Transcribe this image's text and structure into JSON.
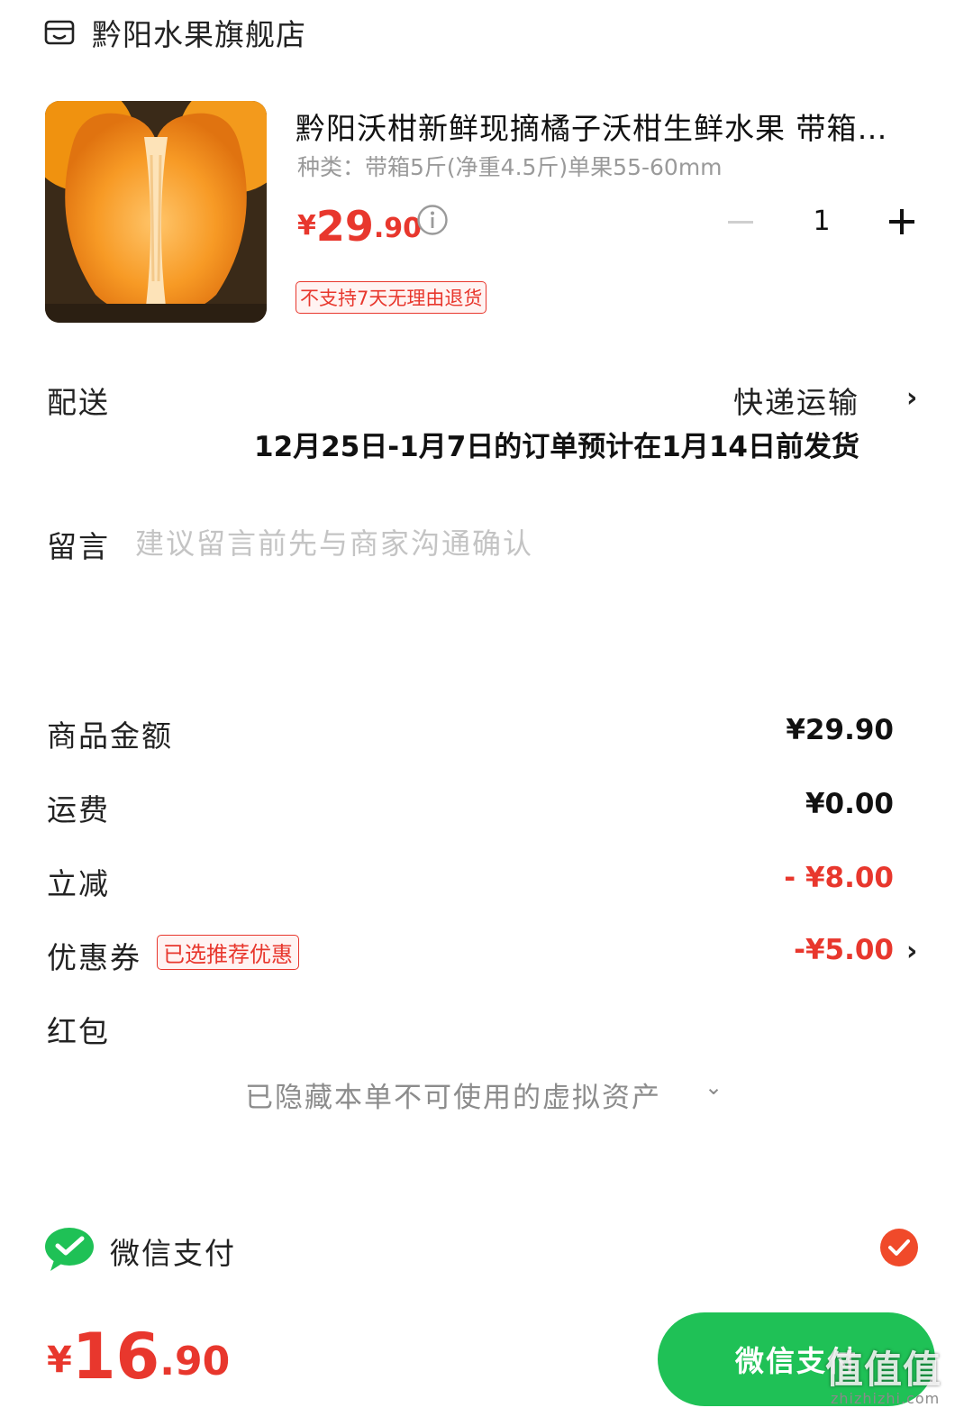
{
  "store": {
    "name": "黔阳水果旗舰店",
    "icon": "store-icon"
  },
  "product": {
    "title": "黔阳沃柑新鲜现摘橘子沃柑生鲜水果 带箱…",
    "spec": "种类：带箱5斤(净重4.5斤)单果55-60mm",
    "price": {
      "symbol": "¥",
      "integer": "29",
      "decimal": ".90"
    },
    "quantity": "1",
    "return_tag": "不支持7天无理由退货",
    "image": "orange-image"
  },
  "delivery": {
    "label": "配送",
    "method": "快递运输",
    "note": "12月25日-1月7日的订单预计在1月14日前发货"
  },
  "message": {
    "label": "留言",
    "placeholder": "建议留言前先与商家沟通确认"
  },
  "summary": {
    "goods_label": "商品金额",
    "goods_value": "¥29.90",
    "shipping_label": "运费",
    "shipping_value": "¥0.00",
    "discount_label": "立减",
    "discount_value": "- ¥8.00",
    "coupon_label": "优惠券",
    "coupon_tag": "已选推荐优惠",
    "coupon_value": "-¥5.00",
    "redpacket_label": "红包",
    "hidden_assets": "已隐藏本单不可使用的虚拟资产"
  },
  "payment": {
    "method": "微信支付",
    "selected": true
  },
  "footer": {
    "total": {
      "symbol": "¥",
      "integer": "16",
      "decimal": ".90"
    },
    "pay_button": "微信支付",
    "watermark": "值值值",
    "watermark_site": "zhizhizhi.com"
  },
  "colors": {
    "accent_red": "#e8372d",
    "wechat_green": "#1fc156",
    "placeholder_gray": "#c4c4c4"
  }
}
